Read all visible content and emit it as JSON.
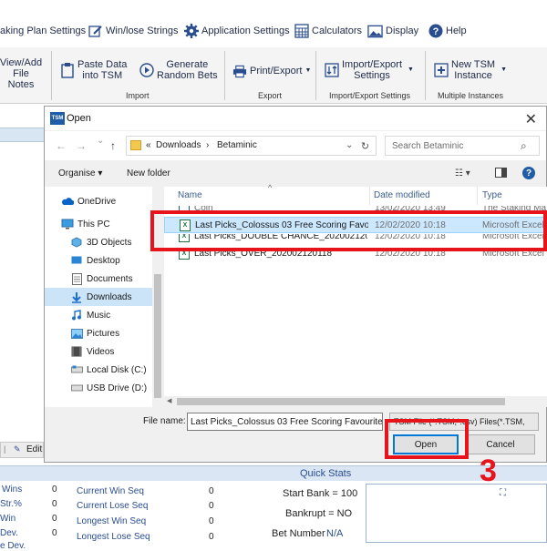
{
  "menubar": {
    "items": [
      {
        "label": "aking Plan Settings",
        "icon": "staking-plan-icon"
      },
      {
        "label": "Win/lose Strings",
        "icon": "edit-icon"
      },
      {
        "label": "Application Settings",
        "icon": "gear-icon"
      },
      {
        "label": "Calculators",
        "icon": "calculator-icon"
      },
      {
        "label": "Display",
        "icon": "image-icon"
      },
      {
        "label": "Help",
        "icon": "help-icon"
      }
    ]
  },
  "ribbon": {
    "view_add": "View/Add",
    "file_notes": "File Notes",
    "paste_data": "Paste Data",
    "into_tsm": "into TSM",
    "generate": "Generate",
    "random_bets": "Random Bets",
    "print_export": "Print/Export",
    "import_export": "Import/Export",
    "settings": "Settings",
    "new_tsm": "New TSM",
    "instance": "Instance",
    "groups": {
      "import": "Import",
      "export": "Export",
      "ie_settings": "Import/Export Settings",
      "multiple": "Multiple Instances"
    }
  },
  "left": {
    "edit": "Edit"
  },
  "quickstats": {
    "title": "Quick Stats",
    "left_labels": [
      "Wins",
      "Str.%",
      "Win",
      "Dev.",
      "e Dev."
    ],
    "left_values": [
      "0",
      "0",
      "0",
      "0",
      "0"
    ],
    "mid_labels": [
      "Current Win Seq",
      "Current Lose Seq",
      "Longest Win Seq",
      "Longest Lose Seq"
    ],
    "mid_values": [
      "0",
      "0",
      "0",
      "0"
    ],
    "start_bank": "Start Bank = 100",
    "bankrupt": "Bankrupt = NO",
    "bet_number_label": "Bet Number",
    "bet_number_value": "N/A"
  },
  "dialog": {
    "title": "Open",
    "app_badge": "TSM",
    "close": "✕",
    "nav": {
      "back": "←",
      "forward": "→",
      "recent": "⌄",
      "up": "↑"
    },
    "breadcrumb": [
      "«",
      "Downloads",
      "›",
      "Betaminic"
    ],
    "refresh": "↻",
    "search_placeholder": "Search Betaminic",
    "toolbar": {
      "organise": "Organise ▾",
      "new_folder": "New folder",
      "view": "☷ ▾",
      "help": "?"
    },
    "tree": [
      {
        "label": "OneDrive",
        "icon": "onedrive-icon"
      },
      {
        "label": "This PC",
        "icon": "pc-icon"
      },
      {
        "label": "3D Objects",
        "icon": "3d-objects-icon"
      },
      {
        "label": "Desktop",
        "icon": "desktop-icon"
      },
      {
        "label": "Documents",
        "icon": "documents-icon"
      },
      {
        "label": "Downloads",
        "icon": "downloads-icon"
      },
      {
        "label": "Music",
        "icon": "music-icon"
      },
      {
        "label": "Pictures",
        "icon": "pictures-icon"
      },
      {
        "label": "Videos",
        "icon": "videos-icon"
      },
      {
        "label": "Local Disk (C:)",
        "icon": "disk-icon"
      },
      {
        "label": "USB Drive (D:)",
        "icon": "usb-icon"
      }
    ],
    "columns": {
      "name": "Name",
      "date": "Date modified",
      "type": "Type"
    },
    "files": [
      {
        "name": "Coin",
        "date": "13/02/2020 13:49",
        "type": "The Staking Mach"
      },
      {
        "name": "Last Picks_Colossus 03 Free Scoring Favo...",
        "date": "12/02/2020 10:18",
        "type": "Microsoft Excel"
      },
      {
        "name": "Last Picks_DOUBLE CHANCE_202002120118",
        "date": "12/02/2020 10:18",
        "type": "Microsoft Excel"
      },
      {
        "name": "Last Picks_OVER_202002120118",
        "date": "12/02/2020 10:18",
        "type": "Microsoft Excel"
      }
    ],
    "filename_label": "File name:",
    "filename_value": "Last Picks_Colossus 03 Free Scoring Favourite",
    "filetype_value": "TSM File (*.TSM,*.csv) Files(*.TSM,",
    "open_button": "Open",
    "cancel_button": "Cancel"
  },
  "annotation": {
    "step": "3",
    "color": "#e8141b"
  }
}
